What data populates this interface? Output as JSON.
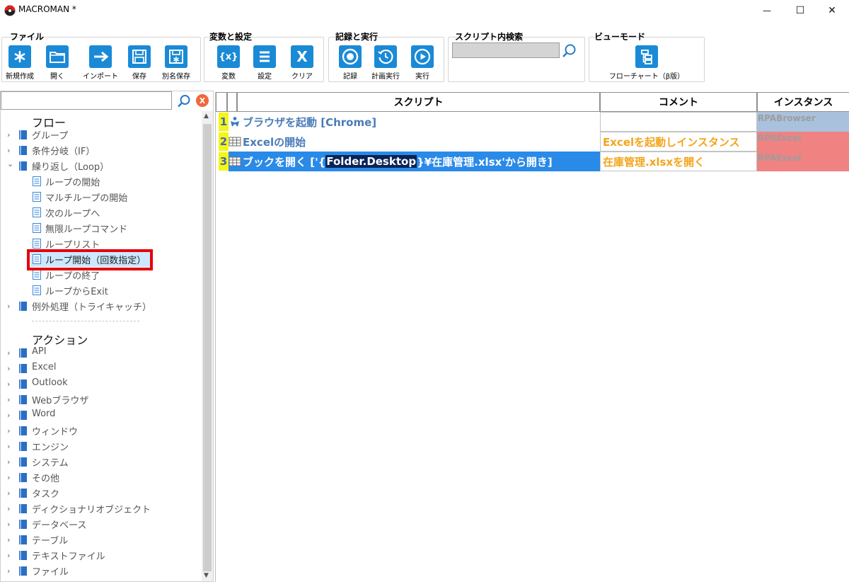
{
  "window": {
    "title": "MACROMAN *",
    "minimize_glyph": "—",
    "maximize_glyph": "☐",
    "close_glyph": "✕"
  },
  "ribbon": {
    "file": {
      "label": "ファイル",
      "buttons": [
        {
          "label": "新規作成",
          "icon": "asterisk-icon"
        },
        {
          "label": "開く",
          "icon": "folder-icon"
        },
        {
          "label": "インポート",
          "icon": "arrow-right-icon"
        },
        {
          "label": "保存",
          "icon": "save-icon"
        },
        {
          "label": "別名保存",
          "icon": "save-as-icon"
        }
      ]
    },
    "vars": {
      "label": "変数と設定",
      "buttons": [
        {
          "label": "変数",
          "glyph": "{x}",
          "icon": "variable-icon"
        },
        {
          "label": "設定",
          "glyph": "☰",
          "icon": "settings-list-icon"
        },
        {
          "label": "クリア",
          "glyph": "X",
          "icon": "clear-icon"
        }
      ]
    },
    "record": {
      "label": "記録と実行",
      "buttons": [
        {
          "label": "記録",
          "icon": "record-icon"
        },
        {
          "label": "計画実行",
          "icon": "schedule-icon"
        },
        {
          "label": "実行",
          "icon": "play-icon"
        }
      ]
    },
    "search": {
      "label": "スクリプト内検索",
      "value": ""
    },
    "view": {
      "label": "ビューモード",
      "buttons": [
        {
          "label": "フローチャート（β版）",
          "icon": "flowchart-icon"
        }
      ]
    }
  },
  "tree": {
    "search_value": "",
    "clear_glyph": "X",
    "flow_header": "フロー",
    "flow_items": [
      {
        "label": "グループ",
        "expanded": false
      },
      {
        "label": "条件分岐（IF）",
        "expanded": false
      },
      {
        "label": "繰り返し（Loop）",
        "expanded": true
      },
      {
        "label": "例外処理（トライキャッチ）",
        "expanded": false
      }
    ],
    "loop_children": [
      "ループの開始",
      "マルチループの開始",
      "次のループへ",
      "無限ループコマンド",
      "ループリスト",
      "ループ開始（回数指定）",
      "ループの終了",
      "ループからExit"
    ],
    "selected_child": "ループ開始（回数指定）",
    "action_header": "アクション",
    "action_items": [
      "API",
      "Excel",
      "Outlook",
      "Webブラウザ",
      "Word",
      "ウィンドウ",
      "エンジン",
      "システム",
      "その他",
      "タスク",
      "ディクショナリオブジェクト",
      "データベース",
      "テーブル",
      "テキストファイル",
      "ファイル"
    ],
    "chevron_collapsed": "›",
    "chevron_expanded": "⌄"
  },
  "grid": {
    "columns": {
      "script": "スクリプト",
      "comment": "コメント",
      "instance": "インスタンス"
    },
    "rows": [
      {
        "num": "1",
        "icon": "browser-icon",
        "script": "ブラウザを起動 [Chrome]",
        "comment": "",
        "instance": "RPABrowser",
        "instance_color": "#a9c1dc"
      },
      {
        "num": "2",
        "icon": "grid-icon",
        "script": "Excelの開始",
        "comment": "Excelを起動しインスタンス",
        "instance": "RPAExcel",
        "instance_color": "#f08282"
      },
      {
        "num": "3",
        "icon": "grid-icon",
        "script_pre": "ブックを開く ['{",
        "script_var": "Folder.Desktop",
        "script_post": "}¥在庫管理.xlsx'から開き]",
        "comment": "在庫管理.xlsxを開く",
        "instance": "RPAExcel",
        "instance_color": "#f08282"
      }
    ]
  },
  "colors": {
    "accent": "#1a8ad6",
    "selection": "#2a8ae8",
    "highlight_border": "#e6000a",
    "comment_text": "#f2a51c",
    "row_number_bg": "#f5f518"
  }
}
